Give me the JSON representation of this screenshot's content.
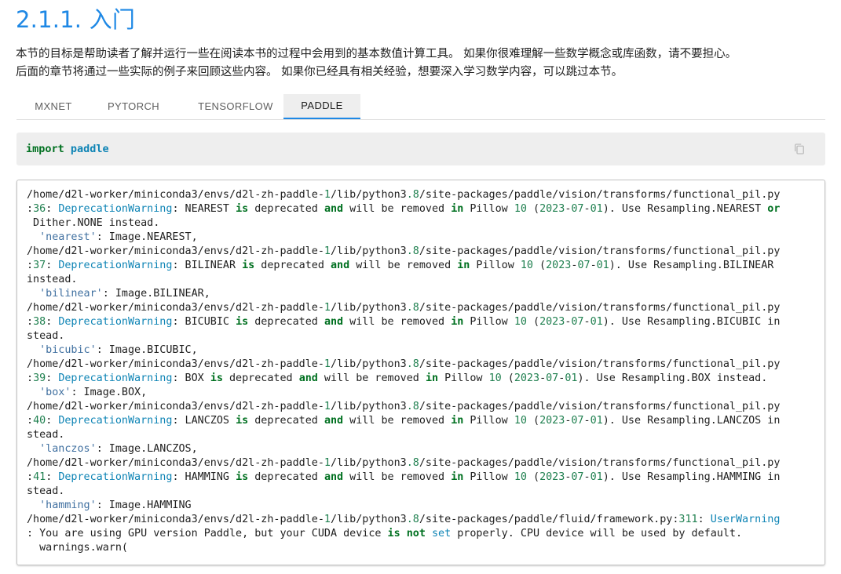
{
  "heading": "2.1.1. 入门",
  "intro": {
    "line1": "本节的目标是帮助读者了解并运行一些在阅读本书的过程中会用到的基本数值计算工具。 如果你很难理解一些数学概念或库函数，请不要担心。",
    "line2": "后面的章节将通过一些实际的例子来回顾这些内容。 如果你已经具有相关经验，想要深入学习数学内容，可以跳过本节。"
  },
  "tabs": [
    {
      "label": "MXNET",
      "active": false
    },
    {
      "label": "PYTORCH",
      "active": false
    },
    {
      "label": "TENSORFLOW",
      "active": false
    },
    {
      "label": "PADDLE",
      "active": true
    }
  ],
  "code_input": {
    "keyword": "import",
    "module": "paddle",
    "copy_icon": "copy-icon"
  },
  "output_lines": [
    [
      [
        "t",
        "/home/d2l-worker/miniconda3/envs/d2l-zh-paddle-"
      ],
      [
        "n",
        "1"
      ],
      [
        "t",
        "/lib/python3"
      ],
      [
        "n",
        ".8"
      ],
      [
        "t",
        "/site-packages/paddle/vision/transforms/functional_pil.py"
      ]
    ],
    [
      [
        "t",
        ":"
      ],
      [
        "n",
        "36"
      ],
      [
        "t",
        ": "
      ],
      [
        "c",
        "DeprecationWarning"
      ],
      [
        "t",
        ": NEAREST "
      ],
      [
        "k",
        "is"
      ],
      [
        "t",
        " deprecated "
      ],
      [
        "k",
        "and"
      ],
      [
        "t",
        " will be removed "
      ],
      [
        "k",
        "in"
      ],
      [
        "t",
        " Pillow "
      ],
      [
        "n",
        "10"
      ],
      [
        "t",
        " ("
      ],
      [
        "n",
        "2023"
      ],
      [
        "t",
        "-"
      ],
      [
        "n",
        "07"
      ],
      [
        "t",
        "-"
      ],
      [
        "n",
        "01"
      ],
      [
        "t",
        "). Use Resampling.NEAREST "
      ],
      [
        "k",
        "or"
      ]
    ],
    [
      [
        "t",
        " Dither.NONE instead."
      ]
    ],
    [
      [
        "t",
        "  "
      ],
      [
        "s",
        "'nearest'"
      ],
      [
        "t",
        ": Image.NEAREST,"
      ]
    ],
    [
      [
        "t",
        "/home/d2l-worker/miniconda3/envs/d2l-zh-paddle-"
      ],
      [
        "n",
        "1"
      ],
      [
        "t",
        "/lib/python3"
      ],
      [
        "n",
        ".8"
      ],
      [
        "t",
        "/site-packages/paddle/vision/transforms/functional_pil.py"
      ]
    ],
    [
      [
        "t",
        ":"
      ],
      [
        "n",
        "37"
      ],
      [
        "t",
        ": "
      ],
      [
        "c",
        "DeprecationWarning"
      ],
      [
        "t",
        ": BILINEAR "
      ],
      [
        "k",
        "is"
      ],
      [
        "t",
        " deprecated "
      ],
      [
        "k",
        "and"
      ],
      [
        "t",
        " will be removed "
      ],
      [
        "k",
        "in"
      ],
      [
        "t",
        " Pillow "
      ],
      [
        "n",
        "10"
      ],
      [
        "t",
        " ("
      ],
      [
        "n",
        "2023"
      ],
      [
        "t",
        "-"
      ],
      [
        "n",
        "07"
      ],
      [
        "t",
        "-"
      ],
      [
        "n",
        "01"
      ],
      [
        "t",
        "). Use Resampling.BILINEAR"
      ]
    ],
    [
      [
        "t",
        "instead."
      ]
    ],
    [
      [
        "t",
        "  "
      ],
      [
        "s",
        "'bilinear'"
      ],
      [
        "t",
        ": Image.BILINEAR,"
      ]
    ],
    [
      [
        "t",
        "/home/d2l-worker/miniconda3/envs/d2l-zh-paddle-"
      ],
      [
        "n",
        "1"
      ],
      [
        "t",
        "/lib/python3"
      ],
      [
        "n",
        ".8"
      ],
      [
        "t",
        "/site-packages/paddle/vision/transforms/functional_pil.py"
      ]
    ],
    [
      [
        "t",
        ":"
      ],
      [
        "n",
        "38"
      ],
      [
        "t",
        ": "
      ],
      [
        "c",
        "DeprecationWarning"
      ],
      [
        "t",
        ": BICUBIC "
      ],
      [
        "k",
        "is"
      ],
      [
        "t",
        " deprecated "
      ],
      [
        "k",
        "and"
      ],
      [
        "t",
        " will be removed "
      ],
      [
        "k",
        "in"
      ],
      [
        "t",
        " Pillow "
      ],
      [
        "n",
        "10"
      ],
      [
        "t",
        " ("
      ],
      [
        "n",
        "2023"
      ],
      [
        "t",
        "-"
      ],
      [
        "n",
        "07"
      ],
      [
        "t",
        "-"
      ],
      [
        "n",
        "01"
      ],
      [
        "t",
        "). Use Resampling.BICUBIC in"
      ]
    ],
    [
      [
        "t",
        "stead."
      ]
    ],
    [
      [
        "t",
        "  "
      ],
      [
        "s",
        "'bicubic'"
      ],
      [
        "t",
        ": Image.BICUBIC,"
      ]
    ],
    [
      [
        "t",
        "/home/d2l-worker/miniconda3/envs/d2l-zh-paddle-"
      ],
      [
        "n",
        "1"
      ],
      [
        "t",
        "/lib/python3"
      ],
      [
        "n",
        ".8"
      ],
      [
        "t",
        "/site-packages/paddle/vision/transforms/functional_pil.py"
      ]
    ],
    [
      [
        "t",
        ":"
      ],
      [
        "n",
        "39"
      ],
      [
        "t",
        ": "
      ],
      [
        "c",
        "DeprecationWarning"
      ],
      [
        "t",
        ": BOX "
      ],
      [
        "k",
        "is"
      ],
      [
        "t",
        " deprecated "
      ],
      [
        "k",
        "and"
      ],
      [
        "t",
        " will be removed "
      ],
      [
        "k",
        "in"
      ],
      [
        "t",
        " Pillow "
      ],
      [
        "n",
        "10"
      ],
      [
        "t",
        " ("
      ],
      [
        "n",
        "2023"
      ],
      [
        "t",
        "-"
      ],
      [
        "n",
        "07"
      ],
      [
        "t",
        "-"
      ],
      [
        "n",
        "01"
      ],
      [
        "t",
        "). Use Resampling.BOX instead."
      ]
    ],
    [
      [
        "t",
        "  "
      ],
      [
        "s",
        "'box'"
      ],
      [
        "t",
        ": Image.BOX,"
      ]
    ],
    [
      [
        "t",
        "/home/d2l-worker/miniconda3/envs/d2l-zh-paddle-"
      ],
      [
        "n",
        "1"
      ],
      [
        "t",
        "/lib/python3"
      ],
      [
        "n",
        ".8"
      ],
      [
        "t",
        "/site-packages/paddle/vision/transforms/functional_pil.py"
      ]
    ],
    [
      [
        "t",
        ":"
      ],
      [
        "n",
        "40"
      ],
      [
        "t",
        ": "
      ],
      [
        "c",
        "DeprecationWarning"
      ],
      [
        "t",
        ": LANCZOS "
      ],
      [
        "k",
        "is"
      ],
      [
        "t",
        " deprecated "
      ],
      [
        "k",
        "and"
      ],
      [
        "t",
        " will be removed "
      ],
      [
        "k",
        "in"
      ],
      [
        "t",
        " Pillow "
      ],
      [
        "n",
        "10"
      ],
      [
        "t",
        " ("
      ],
      [
        "n",
        "2023"
      ],
      [
        "t",
        "-"
      ],
      [
        "n",
        "07"
      ],
      [
        "t",
        "-"
      ],
      [
        "n",
        "01"
      ],
      [
        "t",
        "). Use Resampling.LANCZOS in"
      ]
    ],
    [
      [
        "t",
        "stead."
      ]
    ],
    [
      [
        "t",
        "  "
      ],
      [
        "s",
        "'lanczos'"
      ],
      [
        "t",
        ": Image.LANCZOS,"
      ]
    ],
    [
      [
        "t",
        "/home/d2l-worker/miniconda3/envs/d2l-zh-paddle-"
      ],
      [
        "n",
        "1"
      ],
      [
        "t",
        "/lib/python3"
      ],
      [
        "n",
        ".8"
      ],
      [
        "t",
        "/site-packages/paddle/vision/transforms/functional_pil.py"
      ]
    ],
    [
      [
        "t",
        ":"
      ],
      [
        "n",
        "41"
      ],
      [
        "t",
        ": "
      ],
      [
        "c",
        "DeprecationWarning"
      ],
      [
        "t",
        ": HAMMING "
      ],
      [
        "k",
        "is"
      ],
      [
        "t",
        " deprecated "
      ],
      [
        "k",
        "and"
      ],
      [
        "t",
        " will be removed "
      ],
      [
        "k",
        "in"
      ],
      [
        "t",
        " Pillow "
      ],
      [
        "n",
        "10"
      ],
      [
        "t",
        " ("
      ],
      [
        "n",
        "2023"
      ],
      [
        "t",
        "-"
      ],
      [
        "n",
        "07"
      ],
      [
        "t",
        "-"
      ],
      [
        "n",
        "01"
      ],
      [
        "t",
        "). Use Resampling.HAMMING in"
      ]
    ],
    [
      [
        "t",
        "stead."
      ]
    ],
    [
      [
        "t",
        "  "
      ],
      [
        "s",
        "'hamming'"
      ],
      [
        "t",
        ": Image.HAMMING"
      ]
    ],
    [
      [
        "t",
        "/home/d2l-worker/miniconda3/envs/d2l-zh-paddle-"
      ],
      [
        "n",
        "1"
      ],
      [
        "t",
        "/lib/python3"
      ],
      [
        "n",
        ".8"
      ],
      [
        "t",
        "/site-packages/paddle/fluid/framework.py:"
      ],
      [
        "n",
        "311"
      ],
      [
        "t",
        ": "
      ],
      [
        "c",
        "UserWarning"
      ]
    ],
    [
      [
        "t",
        ": You are using GPU version Paddle, but your CUDA device "
      ],
      [
        "k",
        "is not"
      ],
      [
        "t",
        " "
      ],
      [
        "c",
        "set"
      ],
      [
        "t",
        " properly. CPU device will be used by default."
      ]
    ],
    [
      [
        "t",
        "  warnings.warn("
      ]
    ]
  ],
  "colors": {
    "accent": "#1e88e5",
    "keyword": "#007020",
    "name": "#0e84b5",
    "number": "#208050",
    "string": "#4070a0"
  }
}
